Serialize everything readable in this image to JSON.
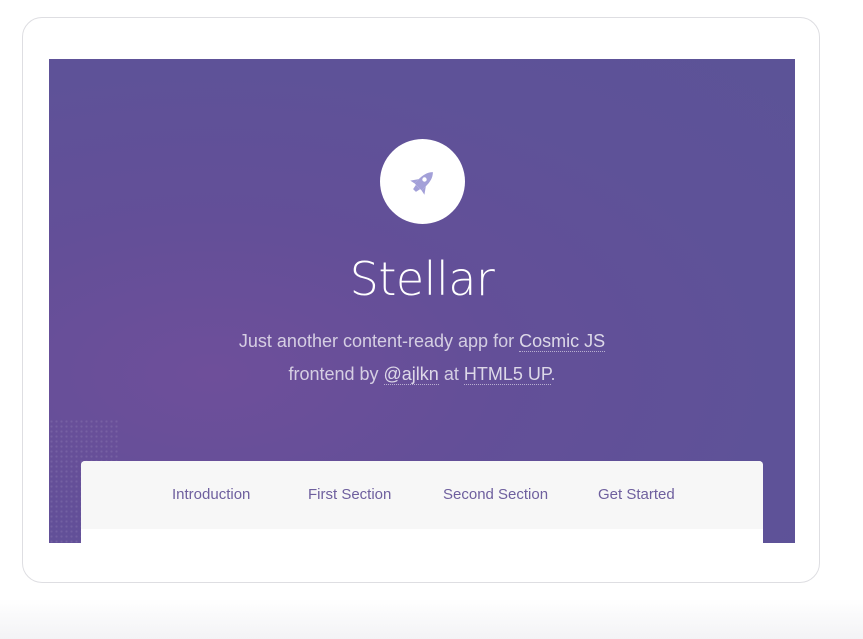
{
  "site": {
    "title": "Stellar",
    "logo_icon": "rocket-icon",
    "tagline_prefix": "Just another content-ready app for ",
    "cosmic_link": "Cosmic JS",
    "frontend_prefix": "frontend by ",
    "author_link": "@ajlkn",
    "at_text": " at ",
    "html5up_link": "HTML5 UP",
    "period": "."
  },
  "nav": {
    "items": [
      {
        "label": "Introduction"
      },
      {
        "label": "First Section"
      },
      {
        "label": "Second Section"
      },
      {
        "label": "Get Started"
      }
    ]
  },
  "colors": {
    "header_bg": "#5f5297",
    "accent_icon": "#a3a0d8",
    "nav_text": "#6e5f9e"
  }
}
